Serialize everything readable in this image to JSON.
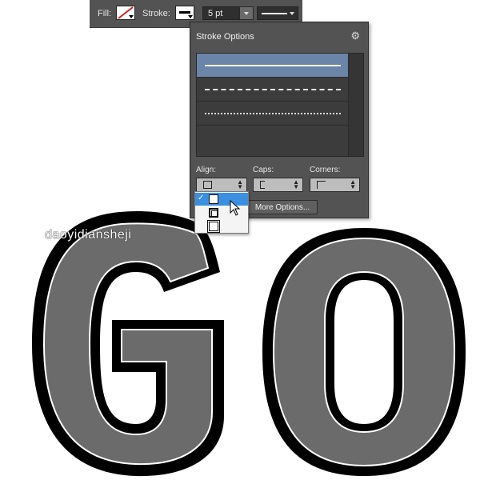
{
  "options_bar": {
    "fill_label": "Fill:",
    "stroke_label": "Stroke:",
    "stroke_weight": "5 pt"
  },
  "stroke_panel": {
    "title": "Stroke Options",
    "profiles": [
      "solid",
      "dashed",
      "dotted"
    ],
    "selected_profile": "solid",
    "align_label": "Align:",
    "caps_label": "Caps:",
    "corners_label": "Corners:",
    "more_options_label": "More Options..."
  },
  "align_menu": {
    "items": [
      "align-center-icon",
      "align-inside-icon",
      "align-outside-icon"
    ],
    "selected_index": 0,
    "check_mark": "✓"
  },
  "canvas": {
    "watermark": "daoyidiansheji",
    "artwork_letters": "GO",
    "letter_fill_color": "#6b6b6b",
    "stroke_color": "#000000",
    "inner_stroke_color": "#ffffff"
  },
  "colors": {
    "panel_bg": "#535353",
    "selection_blue": "#3b8fe0",
    "profile_highlight": "#6b85a8"
  }
}
